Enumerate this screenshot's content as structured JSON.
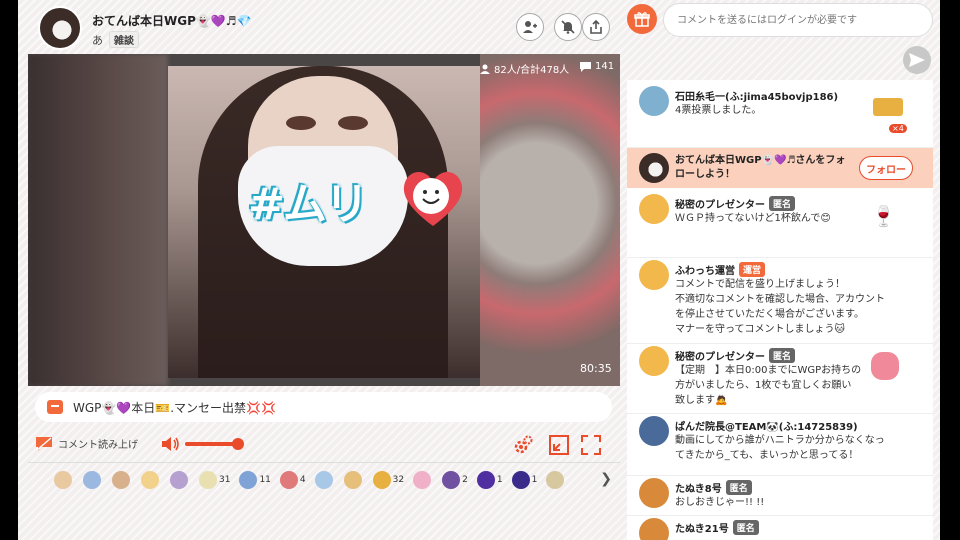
{
  "header": {
    "host_name": "おてんば本日WGP👻💜♬💎",
    "host_sub": "あ",
    "category": "雑談"
  },
  "video": {
    "stamp_text": "#ムリ",
    "viewers": "82人/合計478人",
    "comment_count": "141",
    "elapsed": "80:35"
  },
  "title_bar": {
    "text": "WGP👻💜本日🎫.マンセー出禁💢💢"
  },
  "controls": {
    "read_aloud_label": "コメント読み上げ",
    "volume": 1.0
  },
  "gifts": [
    {
      "icon": "gift-1-icon",
      "color": "#e8c9a0",
      "count": ""
    },
    {
      "icon": "gift-2-icon",
      "color": "#9ab8e0",
      "count": ""
    },
    {
      "icon": "gift-3-icon",
      "color": "#d9b08c",
      "count": ""
    },
    {
      "icon": "gift-4-icon",
      "color": "#f2d28a",
      "count": ""
    },
    {
      "icon": "gift-5-icon",
      "color": "#b5a0d0",
      "count": ""
    },
    {
      "icon": "gift-6-icon",
      "color": "#e8e0b0",
      "count": "31"
    },
    {
      "icon": "gift-7-icon",
      "color": "#7fa3d6",
      "count": "11"
    },
    {
      "icon": "gift-8-icon",
      "color": "#e07a7a",
      "count": "4"
    },
    {
      "icon": "gift-9-icon",
      "color": "#a8c8e8",
      "count": ""
    },
    {
      "icon": "gift-10-icon",
      "color": "#e6c07a",
      "count": ""
    },
    {
      "icon": "gift-11-icon",
      "color": "#e8b040",
      "count": "32"
    },
    {
      "icon": "gift-12-icon",
      "color": "#f0b0c8",
      "count": ""
    },
    {
      "icon": "gift-13-icon",
      "color": "#7050a0",
      "count": "2"
    },
    {
      "icon": "gift-14-icon",
      "color": "#5030a0",
      "count": "1"
    },
    {
      "icon": "gift-15-icon",
      "color": "#3a2a8a",
      "count": "1"
    },
    {
      "icon": "gift-16-icon",
      "color": "#d8c8a0",
      "count": ""
    }
  ],
  "chat": {
    "input_placeholder": "コメントを送るにはログインが必要です",
    "follow_banner": {
      "text": "おてんば本日WGP👻💜♬さんをフォローしよう！",
      "button_label": "フォロー"
    },
    "comments": [
      {
        "name": "石田糸毛一(ふ:jima45bovjp186)",
        "badge": "",
        "text": "4票投票しました。",
        "avatar_color": "#7fb0d0",
        "gift_count": "×4"
      },
      {
        "name": "秘密のプレゼンター",
        "badge": "匿名",
        "text": "ＷＧＰ持ってないけど1杯飲んで😊",
        "avatar_color": "#f2b84b",
        "gift_count": ""
      },
      {
        "name": "ふわっち運営",
        "badge": "運営",
        "text": "コメントで配信を盛り上げましょう！\n不適切なコメントを確認した場合、アカウント\nを停止させていただく場合がございます。\nマナーを守ってコメントしましょう🐱",
        "avatar_color": "#f2b84b",
        "gift_count": ""
      },
      {
        "name": "秘密のプレゼンター",
        "badge": "匿名",
        "text": "【定期　】本日0:00までにWGPお持ちの\n方がいましたら、1枚でも宜しくお願い\n致します🙇",
        "avatar_color": "#f2b84b",
        "gift_count": ""
      },
      {
        "name": "ぱんだ院長@TEAM🐼(ふ:14725839)",
        "badge": "",
        "text": "動画にしてから誰がハニトラか分からなくなっ\nてきたから_ても、まいっかと思ってる！",
        "avatar_color": "#4a6a9a",
        "gift_count": ""
      },
      {
        "name": "たぬき8号",
        "badge": "匿名",
        "text": "おしおきじゃー!! !!",
        "avatar_color": "#d9893a",
        "gift_count": ""
      },
      {
        "name": "たぬき21号",
        "badge": "匿名",
        "text": "",
        "avatar_color": "#d9893a",
        "gift_count": ""
      }
    ]
  },
  "colors": {
    "accent": "#f26a3b",
    "accent_red": "#e94b2b",
    "follow_bg": "#fbd0bc"
  }
}
